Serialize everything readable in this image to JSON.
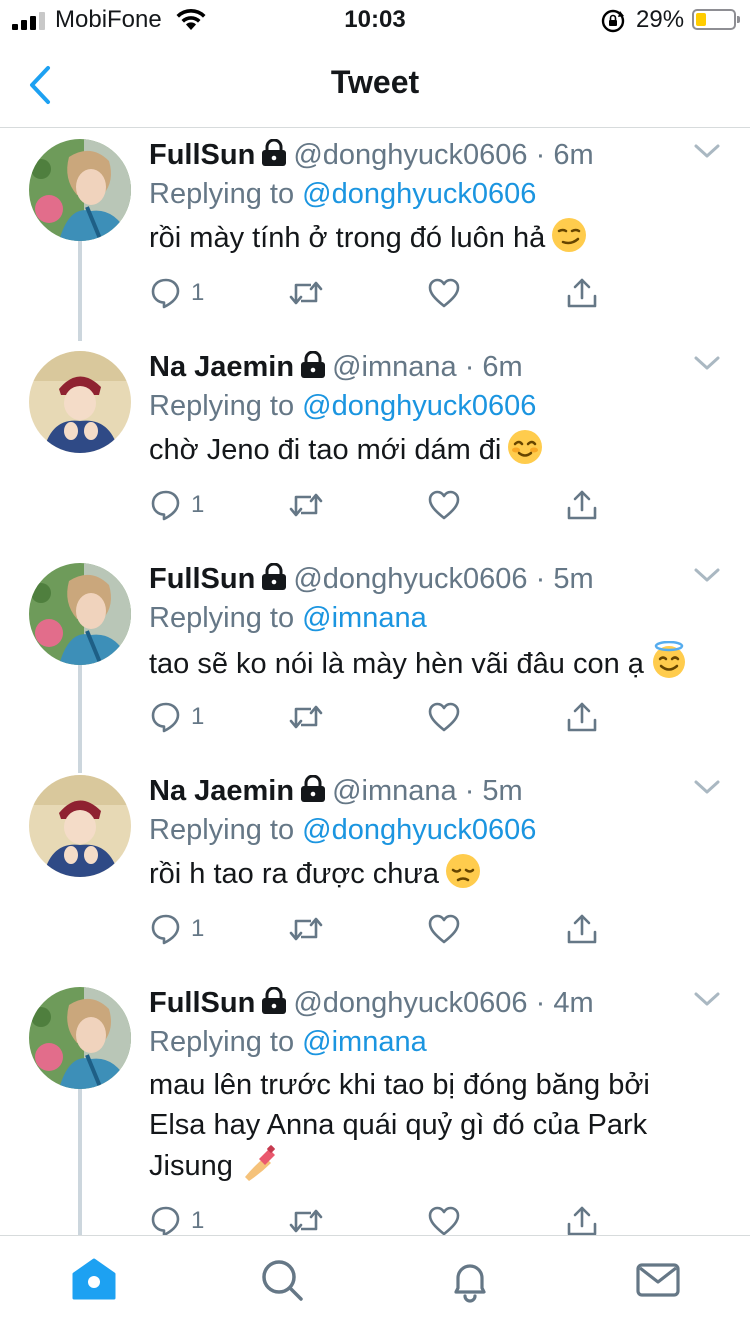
{
  "status_bar": {
    "carrier": "MobiFone",
    "time": "10:03",
    "battery_percent_label": "29%",
    "battery_level": 0.29,
    "signal_bars": 3
  },
  "nav": {
    "title": "Tweet",
    "back_icon": "chevron-left-icon"
  },
  "colors": {
    "accent": "#1da1f2",
    "reply_link": "#1b95e0",
    "secondary_text": "#657786",
    "thread_line": "#ccd6dd"
  },
  "tweets": [
    {
      "name": "FullSun",
      "protected": true,
      "handle": "@donghyuck0606",
      "time": "6m",
      "replying_prefix": "Replying to",
      "replying_to": "@donghyuck0606",
      "text": "rồi mày tính ở trong đó luôn hả",
      "emoji": "smirking-face",
      "reply_count": "1",
      "avatar": "avatar-fullsun"
    },
    {
      "name": "Na Jaemin",
      "protected": true,
      "handle": "@imnana",
      "time": "6m",
      "replying_prefix": "Replying to",
      "replying_to": "@donghyuck0606",
      "text": "chờ Jeno đi tao mới dám đi",
      "emoji": "smiling-face",
      "reply_count": "1",
      "avatar": "avatar-jaemin"
    },
    {
      "name": "FullSun",
      "protected": true,
      "handle": "@donghyuck0606",
      "time": "5m",
      "replying_prefix": "Replying to",
      "replying_to": "@imnana",
      "text": "tao sẽ ko nói là mày hèn vãi đâu con ạ",
      "emoji": "halo-face",
      "reply_count": "1",
      "avatar": "avatar-fullsun"
    },
    {
      "name": "Na Jaemin",
      "protected": true,
      "handle": "@imnana",
      "time": "5m",
      "replying_prefix": "Replying to",
      "replying_to": "@donghyuck0606",
      "text": "rồi h tao ra được chưa",
      "emoji": "pensive-face",
      "reply_count": "1",
      "avatar": "avatar-jaemin"
    },
    {
      "name": "FullSun",
      "protected": true,
      "handle": "@donghyuck0606",
      "time": "4m",
      "replying_prefix": "Replying to",
      "replying_to": "@imnana",
      "text_lines": [
        "mau lên trước khi tao bị đóng băng bởi",
        "Elsa hay Anna quái quỷ gì đó của Park",
        "Jisung"
      ],
      "emoji": "nail-polish",
      "reply_count": "1",
      "avatar": "avatar-fullsun"
    }
  ],
  "tab_bar": {
    "items": [
      "home-icon",
      "search-icon",
      "notifications-icon",
      "messages-icon"
    ],
    "active": "home-icon"
  }
}
